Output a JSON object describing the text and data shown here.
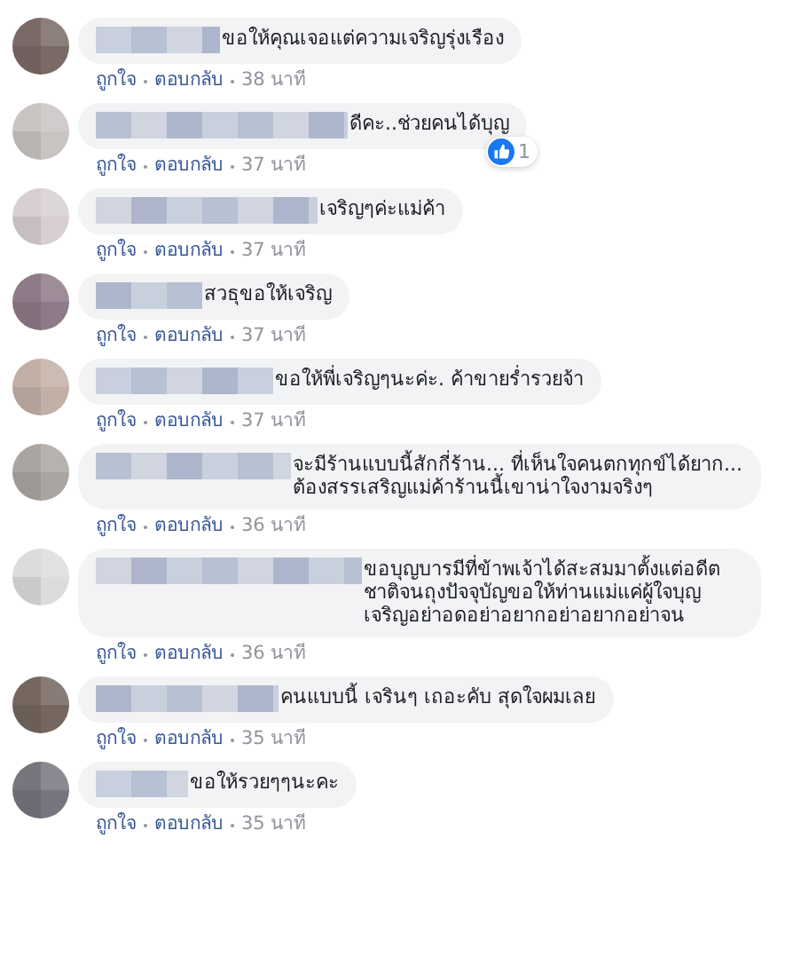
{
  "comments": [
    {
      "color": "#7a6a66",
      "text": "ขอให้คุณเจอแต่ความเจริญรุ่งเรือง",
      "actions": [
        "ถูกใจ",
        "ตอบกลับ"
      ],
      "time": "38 นาที"
    },
    {
      "color": "#c9c4c2",
      "text": "ดีคะ..ช่วยคนได้บุญ",
      "reactions": "1",
      "actions": [
        "ถูกใจ",
        "ตอบกลับ"
      ],
      "time": "37 นาที"
    },
    {
      "color": "#d8cfd0",
      "text": "เจริญๆค่ะแม่ค้า",
      "actions": [
        "ถูกใจ",
        "ตอบกลับ"
      ],
      "time": "37 นาที"
    },
    {
      "color": "#8e7a88",
      "text": "สวธุขอให้เจริญ",
      "actions": [
        "ถูกใจ",
        "ตอบกลับ"
      ],
      "time": "37 นาที"
    },
    {
      "color": "#c2b0a6",
      "text": "ขอให้พี่เจริญๆนะค่ะ. ค้าขายร่ำรวยจ้า",
      "actions": [
        "ถูกใจ",
        "ตอบกลับ"
      ],
      "time": "37 นาที"
    },
    {
      "color": "#aaa5a0",
      "text": "จะมีร้านแบบนี้สักกี่ร้าน... ที่เห็นใจคนตกทุกข์ได้ยาก... ต้องสรรเสริญแม่ค้าร้านนี้เขาน่าใจงามจริงๆ",
      "actions": [
        "ถูกใจ",
        "ตอบกลับ"
      ],
      "time": "36 นาที"
    },
    {
      "color": "#dcdcdc",
      "text": "ขอบุญบารมีที่ข้าพเจ้าได้สะสมมาตั้งแต่อดีตชาติจนถุงปัจจุบัญขอให้ท่านแม่แค่ผู้ใจบุญเจริญอย่าอดอย่าอยากอย่าอยากอย่าจน",
      "actions": [
        "ถูกใจ",
        "ตอบกลับ"
      ],
      "time": "36 นาที"
    },
    {
      "color": "#75665f",
      "text": "คนแบบนี้ เจรินๆ เถอะคับ สุดใจผมเลย",
      "actions": [
        "ถูกใจ",
        "ตอบกลับ"
      ],
      "time": "35 นาที"
    },
    {
      "color": "#75767e",
      "text": "ขอให้รวยๆๆนะคะ",
      "actions": [
        "ถูกใจ",
        "ตอบกลับ"
      ],
      "time": "35 นาที"
    }
  ]
}
